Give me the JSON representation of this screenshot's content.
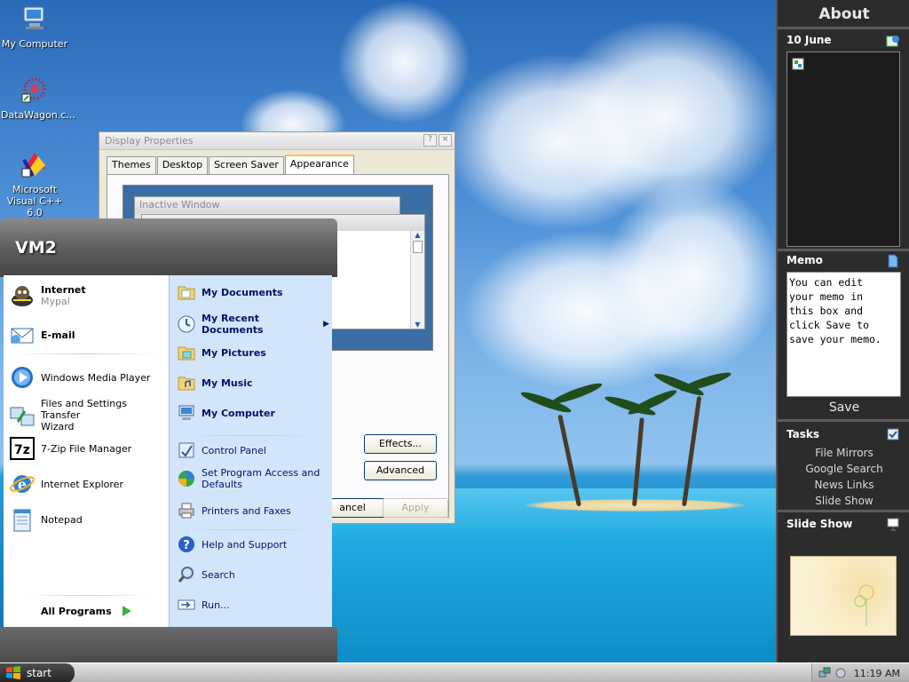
{
  "desktop": {
    "icons": [
      {
        "label": "My Computer"
      },
      {
        "label": "DataWagon.c..."
      },
      {
        "label_line1": "Microsoft",
        "label_line2": "Visual C++ 6.0"
      }
    ]
  },
  "dialog": {
    "title": "Display Properties",
    "help_btn": "?",
    "close_btn": "×",
    "tabs": [
      "Themes",
      "Desktop",
      "Screen Saver",
      "Appearance"
    ],
    "active_tab": "Appearance",
    "inactive_window_label": "Inactive Window",
    "effects_label": "Effects...",
    "advanced_label": "Advanced",
    "cancel_label": "ancel",
    "apply_label": "Apply"
  },
  "start_menu": {
    "user_name": "VM2",
    "pinned": [
      {
        "title": "Internet",
        "subtitle": "Mypal"
      },
      {
        "title": "E-mail"
      }
    ],
    "recent": [
      {
        "label": "Windows Media Player"
      },
      {
        "label_line1": "Files and Settings Transfer",
        "label_line2": "Wizard"
      },
      {
        "label": "7-Zip File Manager"
      },
      {
        "label": "Internet Explorer"
      },
      {
        "label": "Notepad"
      }
    ],
    "all_programs": "All Programs",
    "right_bold": [
      "My Documents",
      "My Recent Documents",
      "My Pictures",
      "My Music",
      "My Computer"
    ],
    "right_system": [
      {
        "label": "Control Panel"
      },
      {
        "label_line1": "Set Program Access and",
        "label_line2": "Defaults"
      },
      {
        "label": "Printers and Faxes"
      }
    ],
    "right_help": [
      "Help and Support",
      "Search",
      "Run..."
    ]
  },
  "sidebar": {
    "title": "About",
    "date_header": "10 June",
    "memo_header": "Memo",
    "memo_text": "You can edit your memo in this box and click Save to save your memo.",
    "save_label": "Save",
    "tasks_header": "Tasks",
    "tasks": [
      "File Mirrors",
      "Google Search",
      "News Links",
      "Slide Show"
    ],
    "slideshow_header": "Slide Show"
  },
  "taskbar": {
    "start_label": "start",
    "clock": "11:19 AM"
  },
  "colors": {
    "start_menu_right": "#d3e5fa",
    "sidebar_bg": "#2c2c2c",
    "link_blue": "#00136b"
  }
}
